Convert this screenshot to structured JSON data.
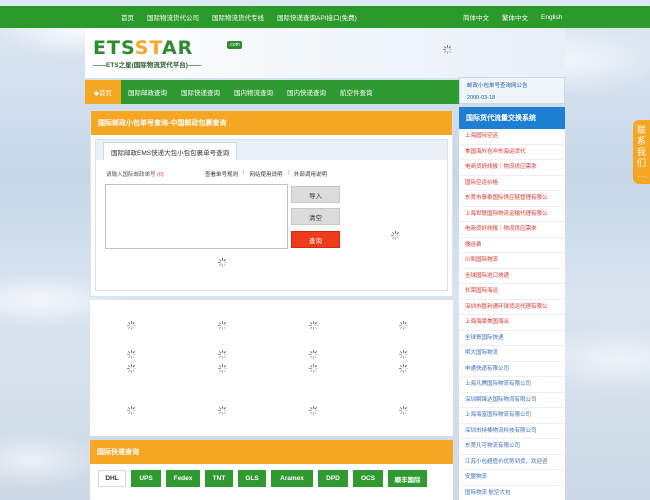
{
  "topbar": {
    "links": [
      "首页",
      "国际物流货代公司",
      "国际物流货代专线",
      "国际快递查询API接口(免费)"
    ],
    "languages": [
      "简体中文",
      "繁体中文",
      "English"
    ]
  },
  "logo": {
    "main_prefix": "ETS",
    "main_accent": "ST",
    "main_suffix": "AR",
    "com": ".com",
    "subtitle": "——ETS之星(国际物流货代平台)——"
  },
  "nav": {
    "home": "◆首页",
    "items": [
      "国际邮政查询",
      "国际快递查询",
      "国内物流查询",
      "国内快递查询",
      "航空件查询"
    ]
  },
  "notice": {
    "title": "邮政小包单号查询网公告",
    "date": "2000-03-18"
  },
  "postal_panel": {
    "title": "国际邮政小包单号查询-中国邮政包裹查询",
    "tab": "国际邮政EMS快递大包小包包裹单号查询",
    "input_label": "请输入国际邮政单号",
    "input_count": "(0)",
    "help_links": [
      "查看单号规则",
      "网站使用说明",
      "外部调用说明"
    ],
    "buttons": {
      "import": "导入",
      "clear": "清空",
      "query": "查询"
    }
  },
  "express_panel": {
    "title": "国际快递查询",
    "tabs": [
      "DHL",
      "UPS",
      "Fedex",
      "TNT",
      "GLS",
      "Aramex",
      "DPD",
      "OCS",
      "顺丰国际"
    ]
  },
  "sidebar": {
    "title": "国际货代流量交换系统",
    "items": [
      {
        "label": "上海国际空运",
        "color": "red"
      },
      {
        "label": "美国海外仓冲东海运货代",
        "color": "red"
      },
      {
        "label": "电商货好线报｜物流供应需求",
        "color": "red"
      },
      {
        "label": "国际空运价格",
        "color": "red"
      },
      {
        "label": "东莞市泰泰国际供应链管理有限公",
        "color": "red"
      },
      {
        "label": "上海世联国际物流运输代理有限公",
        "color": "red"
      },
      {
        "label": "电商货好线报｜物流供应需求",
        "color": "red"
      },
      {
        "label": "搜运费",
        "color": "red"
      },
      {
        "label": "川和国际物流",
        "color": "red"
      },
      {
        "label": "全球国际进口快递",
        "color": "red"
      },
      {
        "label": "长荣国际海运",
        "color": "red"
      },
      {
        "label": "深圳市胜利通环球货运代理有限公",
        "color": "red"
      },
      {
        "label": "上海海豪美国海派",
        "color": "red"
      },
      {
        "label": "全球寄国际快递",
        "color": "blue"
      },
      {
        "label": "明大国际物流",
        "color": "blue"
      },
      {
        "label": "申通快递有限公司",
        "color": "blue"
      },
      {
        "label": "上海凡腾国际物流有限公司",
        "color": "blue"
      },
      {
        "label": "深圳瞬锋达国际物流有限公司",
        "color": "blue"
      },
      {
        "label": "上海海富国际物流有限公司",
        "color": "blue"
      },
      {
        "label": "深圳市特棒物流科技有限公司",
        "color": "blue"
      },
      {
        "label": "东莞凡可物流有限公司",
        "color": "blue"
      },
      {
        "label": "江苏小包超值价优势到货，欢迎咨",
        "color": "blue"
      },
      {
        "label": "安盟物流",
        "color": "blue"
      },
      {
        "label": "国际物流 航空大包",
        "color": "blue"
      }
    ]
  },
  "contact": {
    "chars": [
      "联",
      "系",
      "我",
      "们",
      "…"
    ]
  }
}
